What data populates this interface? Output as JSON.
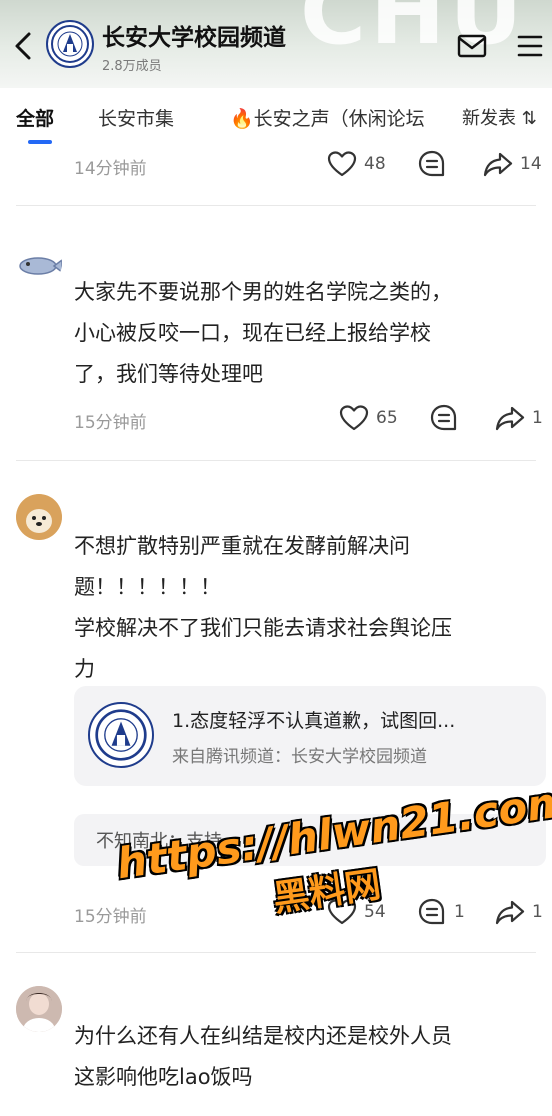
{
  "header": {
    "title": "长安大学校园频道",
    "members": "2.8万成员",
    "bg_word": "CHU"
  },
  "tabs": [
    {
      "label": "全部"
    },
    {
      "label": "长安市集"
    },
    {
      "label": "🔥长安之声（休闲论坛"
    },
    {
      "label": "新发表 ⇅"
    }
  ],
  "posts": [
    {
      "time": "14分钟前",
      "likes": "48",
      "comments": "",
      "shares": "14"
    },
    {
      "text_lines": [
        "大家先不要说那个男的姓名学院之类的，",
        "小心被反咬一口，现在已经上报给学校",
        "了，我们等待处理吧"
      ],
      "time": "15分钟前",
      "likes": "65",
      "shares": "1"
    },
    {
      "text_lines": [
        "不想扩散特别严重就在发酵前解决问",
        "题！！！！！！",
        "学校解决不了我们只能去请求社会舆论压",
        "力"
      ],
      "quote": {
        "title": "1.态度轻浮不认真道歉，试图回...",
        "source": "来自腾讯频道：长安大学校园频道"
      },
      "reply": "不知南北：支持",
      "time": "15分钟前",
      "likes": "54",
      "comments": "1",
      "shares": "1"
    },
    {
      "text_lines": [
        "为什么还有人在纠结是校内还是校外人员",
        "这影响他吃lao饭吗"
      ]
    }
  ],
  "watermark": {
    "line1": "https://hlwn21.com",
    "line2": "黑料网"
  },
  "colors": {
    "accent": "#2368f5",
    "logo_blue": "#1f3c8c",
    "watermark": "#ff9a1c"
  }
}
